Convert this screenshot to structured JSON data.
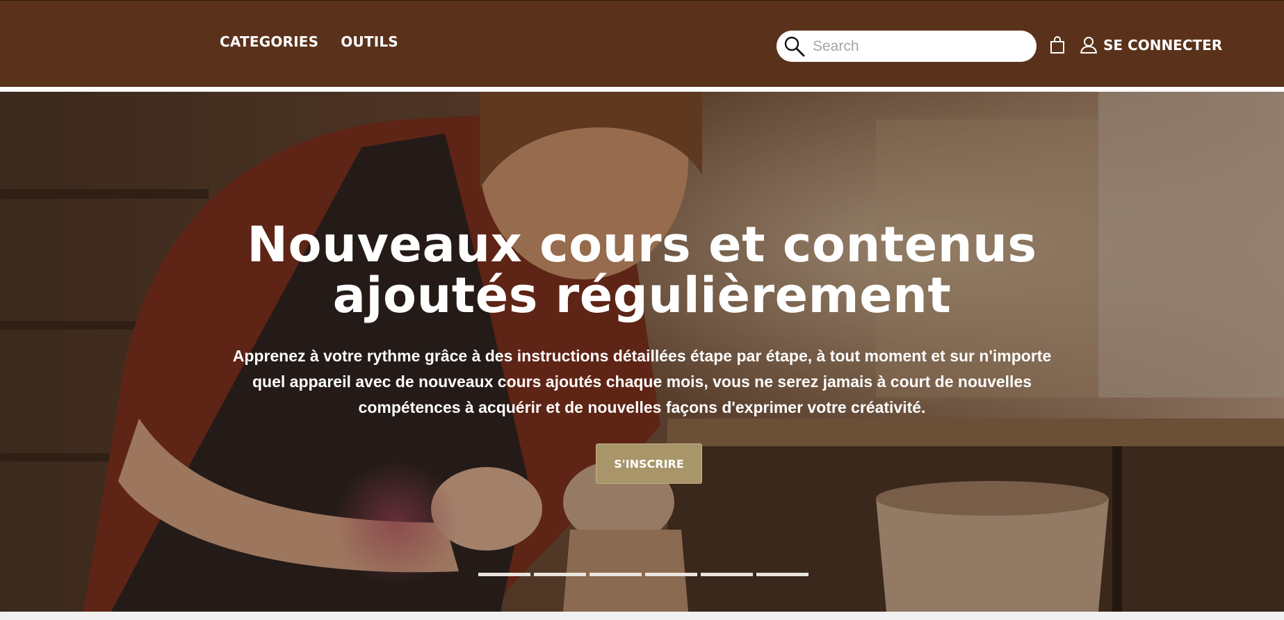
{
  "header": {
    "nav": [
      {
        "label": "CATEGORIES"
      },
      {
        "label": "OUTILS"
      }
    ],
    "search": {
      "placeholder": "Search",
      "value": ""
    },
    "cart_icon": "shopping-bag-icon",
    "login": {
      "label": "SE CONNECTER",
      "icon": "user-icon"
    }
  },
  "hero": {
    "image": "woman shaping clay on a pottery wheel in a workshop",
    "title_line1": "Nouveaux cours et contenus",
    "title_line2": "ajoutés régulièrement",
    "text_line1": "Apprenez à votre rythme grâce à des instructions détaillées étape par étape, à tout moment et sur n'importe",
    "text_line2": "quel appareil avec de nouveaux cours ajoutés chaque mois, vous ne serez jamais à court de nouvelles",
    "text_line3": "compétences à acquérir et de nouvelles façons d'exprimer votre créativité.",
    "cta_label": "S'INSCRIRE",
    "slide_count": 6
  },
  "colors": {
    "header_bg": "#5a321b",
    "cta_bg": "#a8966a",
    "text": "#ffffff"
  }
}
